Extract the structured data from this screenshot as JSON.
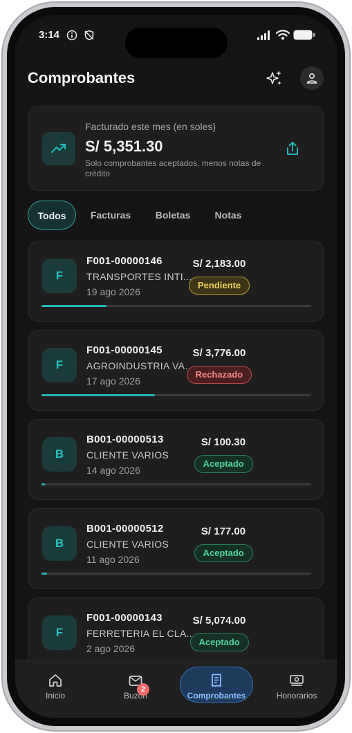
{
  "status_bar": {
    "time": "3:14"
  },
  "header": {
    "title": "Comprobantes"
  },
  "summary": {
    "label": "Facturado este mes (en soles)",
    "value": "S/ 5,351.30",
    "note": "Solo comprobantes aceptados, menos notas de crédito"
  },
  "tabs": [
    {
      "label": "Todos"
    },
    {
      "label": "Facturas"
    },
    {
      "label": "Boletas"
    },
    {
      "label": "Notas"
    }
  ],
  "invoices": [
    {
      "type": "F",
      "number": "F001-00000146",
      "client": "TRANSPORTES INTI...",
      "date": "19 ago 2026",
      "amount": "S/ 2,183.00",
      "status": "Pendiente",
      "progress": 0.24
    },
    {
      "type": "F",
      "number": "F001-00000145",
      "client": "AGROINDUSTRIA VAL...",
      "date": "17 ago 2026",
      "amount": "S/ 3,776.00",
      "status": "Rechazado",
      "progress": 0.42
    },
    {
      "type": "B",
      "number": "B001-00000513",
      "client": "CLIENTE VARIOS",
      "date": "14 ago 2026",
      "amount": "S/ 100.30",
      "status": "Aceptado",
      "progress": 0.01
    },
    {
      "type": "B",
      "number": "B001-00000512",
      "client": "CLIENTE VARIOS",
      "date": "11 ago 2026",
      "amount": "S/ 177.00",
      "status": "Aceptado",
      "progress": 0.02
    },
    {
      "type": "F",
      "number": "F001-00000143",
      "client": "FERRETERIA EL CLAV...",
      "date": "2 ago 2026",
      "amount": "S/ 5,074.00",
      "status": "Aceptado",
      "progress": 0
    }
  ],
  "bottom_nav": [
    {
      "label": "Inicio",
      "icon": "home-icon"
    },
    {
      "label": "Buzón",
      "icon": "mail-icon",
      "badge": "2"
    },
    {
      "label": "Comprobantes",
      "icon": "receipt-icon"
    },
    {
      "label": "Honorarios",
      "icon": "cash-icon"
    }
  ],
  "colors": {
    "accent": "#22b7b4",
    "pending": "#f0d25a",
    "rejected": "#f08a8a",
    "accepted": "#4fd39a",
    "nav_active": "#8ec0ff"
  }
}
